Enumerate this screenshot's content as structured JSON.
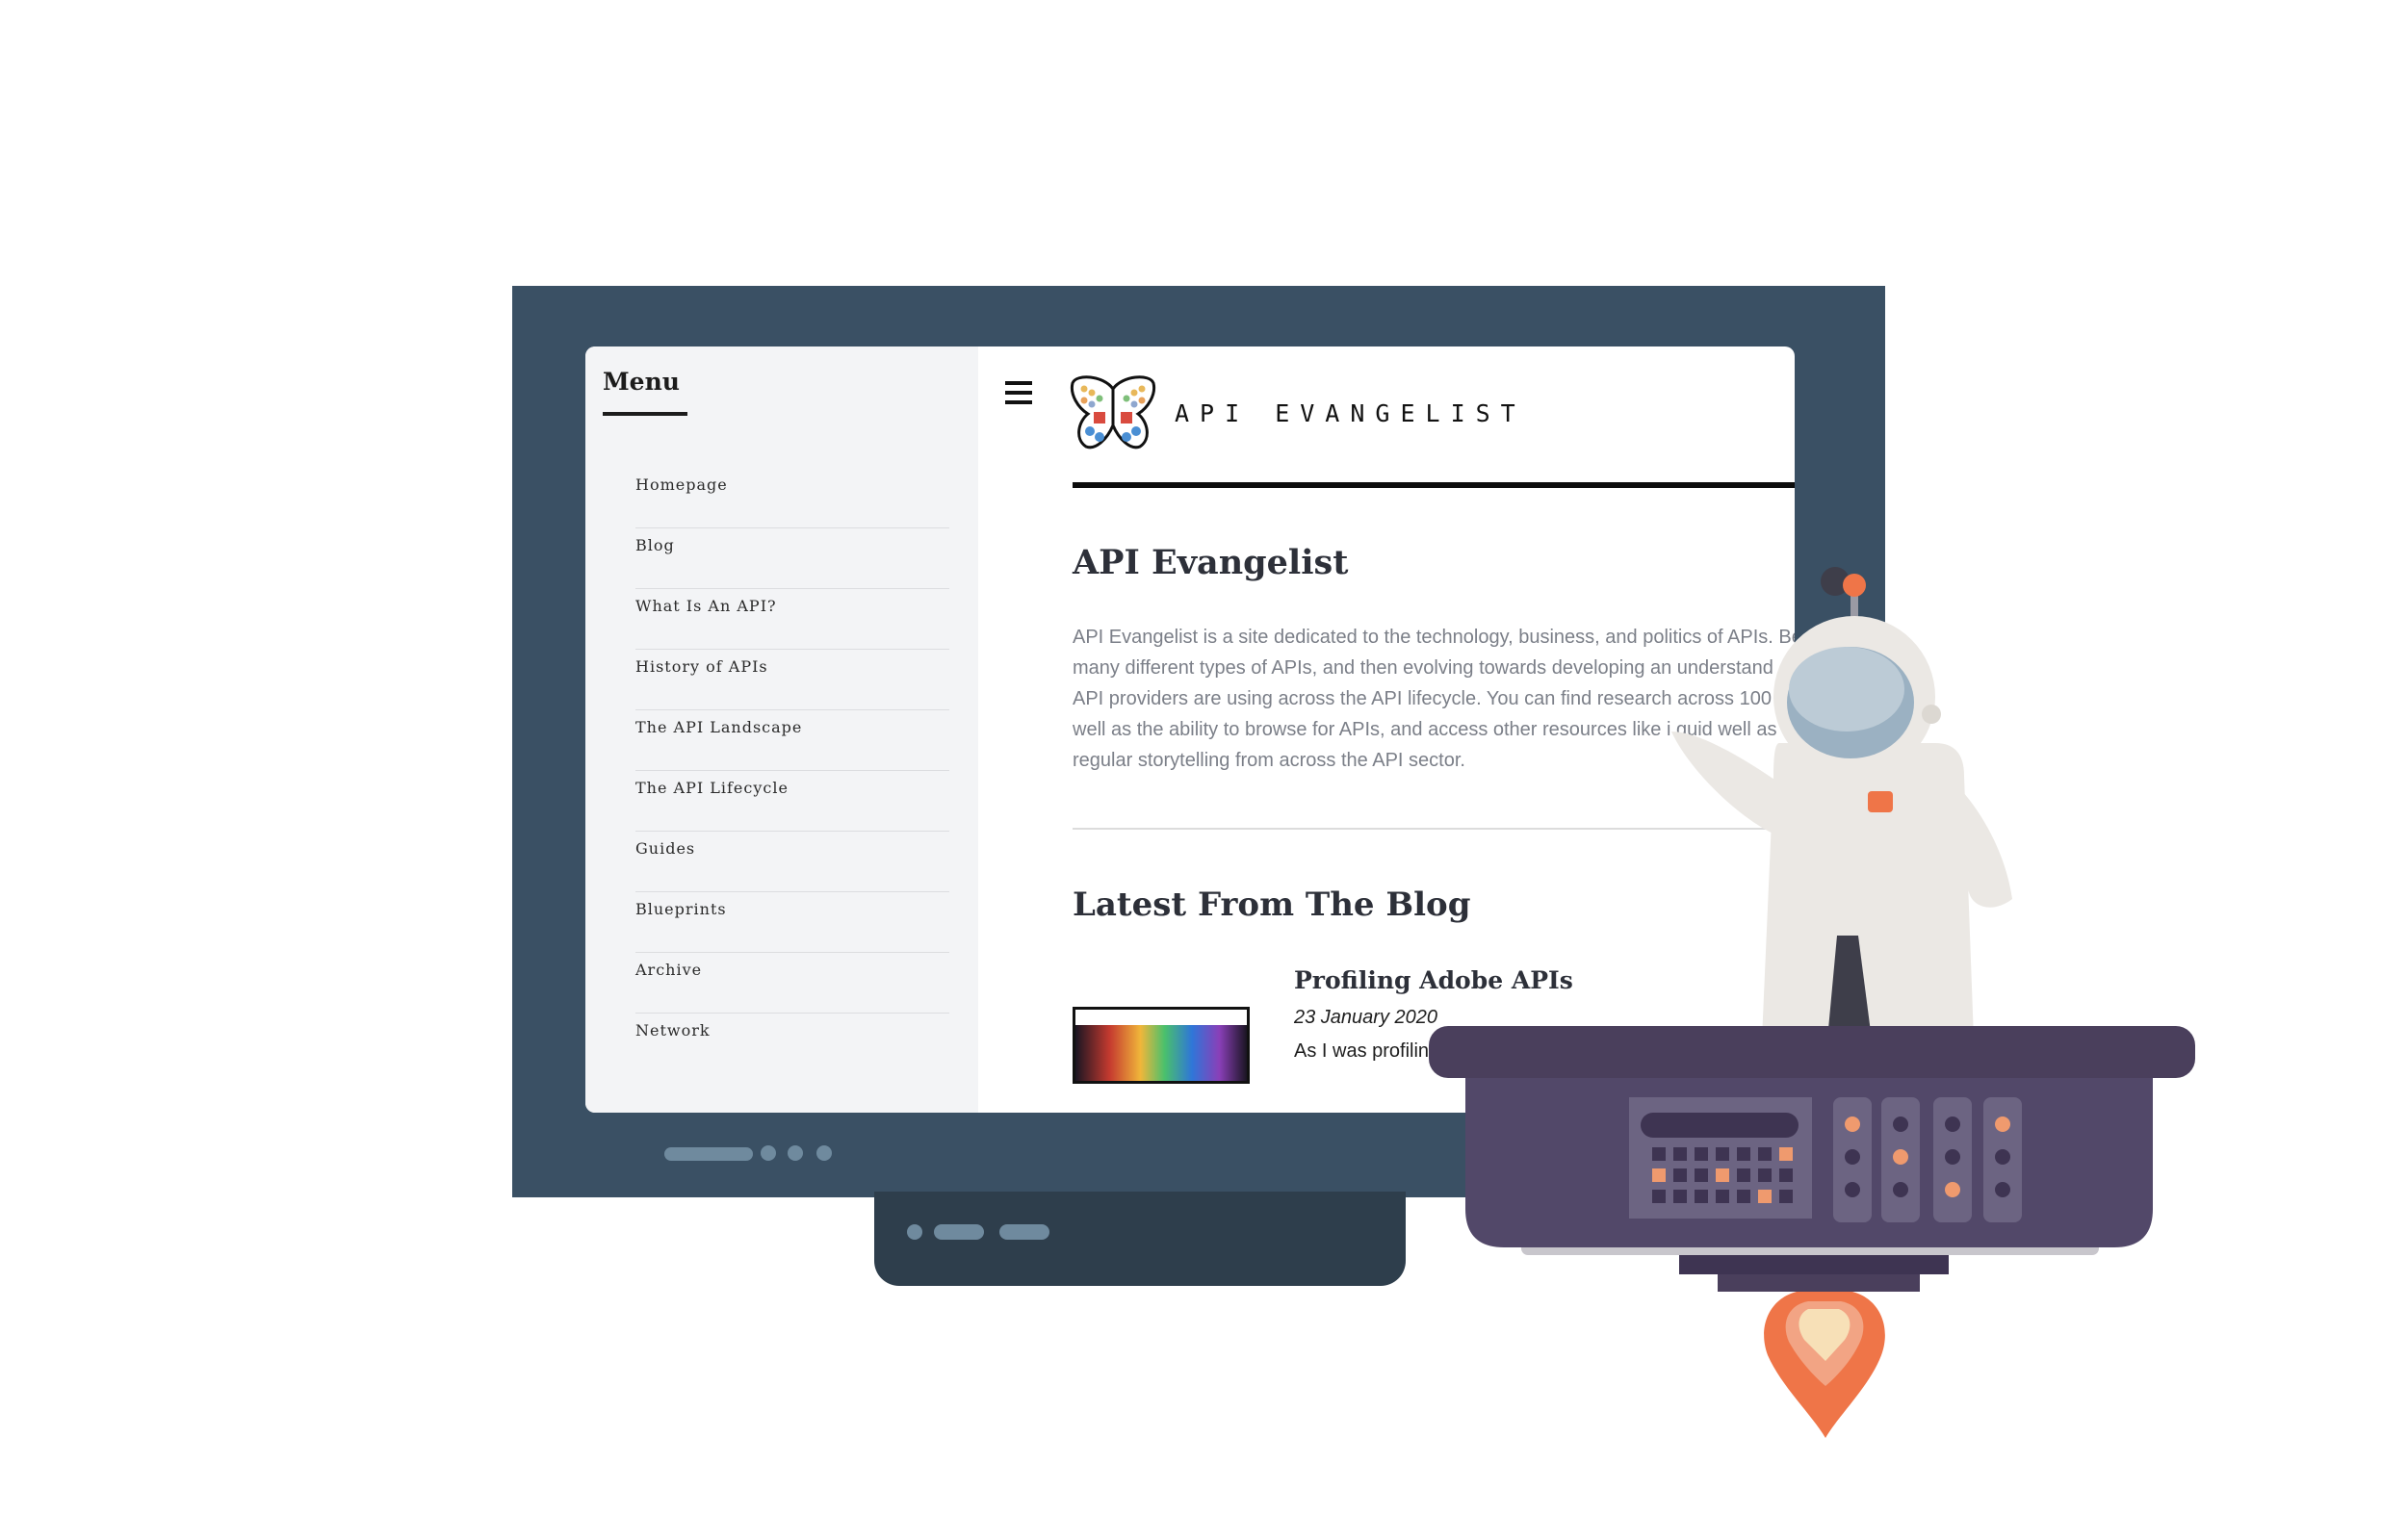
{
  "sidebar": {
    "heading": "Menu",
    "items": [
      {
        "label": "Homepage"
      },
      {
        "label": "Blog"
      },
      {
        "label": "What Is An API?"
      },
      {
        "label": "History of APIs"
      },
      {
        "label": "The API Landscape"
      },
      {
        "label": "The API Lifecycle"
      },
      {
        "label": "Guides"
      },
      {
        "label": "Blueprints"
      },
      {
        "label": "Archive"
      },
      {
        "label": "Network"
      }
    ]
  },
  "header": {
    "brand_text": "API EVANGELIST",
    "menu_icon": "hamburger-icon",
    "logo_icon": "butterfly-logo-icon"
  },
  "main": {
    "title": "API Evangelist",
    "intro": "API Evangelist is a site dedicated to the technology, business, and politics of APIs. Be many different types of APIs, and then evolving towards developing an understand API providers are using across the API lifecycle. You can find research across 100 s well as the ability to browse for APIs, and access other resources like i guid well as a regular storytelling from across the API sector.",
    "blog_heading": "Latest From The Blog",
    "post": {
      "title": "Profiling Adobe APIs",
      "date": "23 January 2020",
      "excerpt": "As I was profiling companies alphabe"
    }
  },
  "colors": {
    "monitor_frame": "#3a5064",
    "monitor_stand": "#2e3e4c",
    "sidebar_bg": "#f3f4f6",
    "rocket_body": "#524869",
    "rocket_top": "#4a3f5c",
    "accent_orange": "#ef7548",
    "astronaut_suit": "#ebe8e4",
    "helmet_visor": "#bccbd6"
  }
}
